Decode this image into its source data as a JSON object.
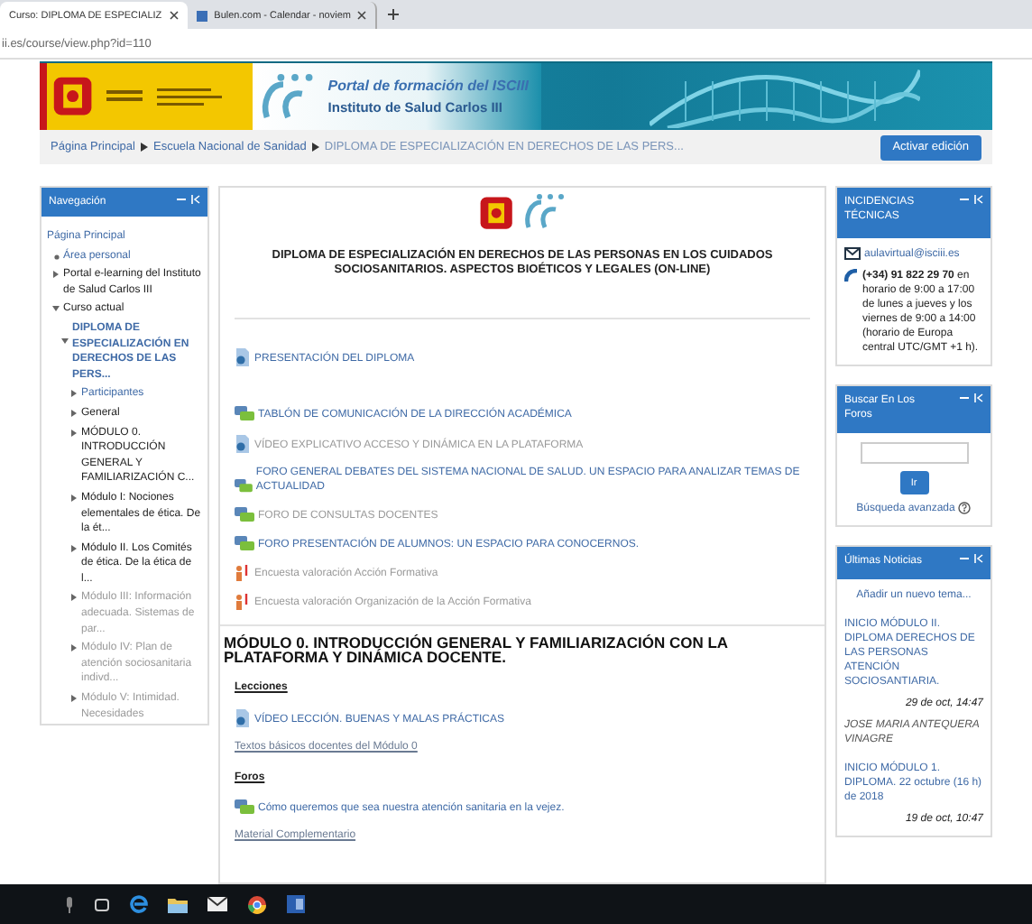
{
  "browser": {
    "tabs": [
      {
        "title": "Curso: DIPLOMA DE ESPECIALIZ",
        "selected": true
      },
      {
        "title": "Bulen.com - Calendar - noviem",
        "selected": false
      }
    ],
    "address": "ii.es/course/view.php?id=110"
  },
  "banner": {
    "title": "Portal de formación del ISCIII",
    "subtitle": "Instituto de Salud Carlos III"
  },
  "breadcrumb": [
    "Página Principal",
    "Escuela Nacional de Sanidad",
    "DIPLOMA DE ESPECIALIZACIÓN EN DERECHOS DE LAS PERS..."
  ],
  "edit_button": "Activar edición",
  "navigation": {
    "title": "Navegación",
    "items": [
      {
        "label": "Página Principal",
        "kind": "root",
        "link": true,
        "current": false,
        "dimmed": false,
        "children": [
          {
            "label": "Área personal",
            "kind": "bullet",
            "link": true,
            "current": false,
            "dimmed": false
          },
          {
            "label": "Portal e-learning del Instituto de Salud Carlos III",
            "kind": "branch",
            "link": false,
            "current": false,
            "dimmed": false,
            "expanded": false
          },
          {
            "label": "Curso actual",
            "kind": "branch",
            "link": false,
            "current": false,
            "dimmed": false,
            "expanded": true,
            "children": [
              {
                "label": "DIPLOMA DE ESPECIALIZACIÓN EN DERECHOS DE LAS PERS...",
                "kind": "branch",
                "link": true,
                "current": true,
                "dimmed": false,
                "expanded": true,
                "children": [
                  {
                    "label": "Participantes",
                    "kind": "branch",
                    "link": true,
                    "current": false,
                    "dimmed": false,
                    "expanded": false
                  },
                  {
                    "label": "General",
                    "kind": "branch",
                    "link": false,
                    "current": false,
                    "dimmed": false,
                    "expanded": false
                  },
                  {
                    "label": "MÓDULO 0. INTRODUCCIÓN GENERAL Y FAMILIARIZACIÓN C...",
                    "kind": "branch",
                    "link": false,
                    "current": false,
                    "dimmed": false,
                    "expanded": false
                  },
                  {
                    "label": "Módulo I: Nociones elementales de ética. De la ét...",
                    "kind": "branch",
                    "link": false,
                    "current": false,
                    "dimmed": false,
                    "expanded": false
                  },
                  {
                    "label": "Módulo II. Los Comités de ética. De la ética de l...",
                    "kind": "branch",
                    "link": false,
                    "current": false,
                    "dimmed": false,
                    "expanded": false
                  },
                  {
                    "label": "Módulo III: Información adecuada. Sistemas de par...",
                    "kind": "branch",
                    "link": false,
                    "current": false,
                    "dimmed": true,
                    "expanded": false
                  },
                  {
                    "label": "Módulo IV: Plan de atención sociosanitaria indivd...",
                    "kind": "branch",
                    "link": false,
                    "current": false,
                    "dimmed": true,
                    "expanded": false
                  },
                  {
                    "label": "Módulo V: Intimidad. Necesidades",
                    "kind": "branch",
                    "link": false,
                    "current": false,
                    "dimmed": true,
                    "expanded": false
                  }
                ]
              }
            ]
          }
        ]
      }
    ]
  },
  "course": {
    "title": "DIPLOMA DE ESPECIALIZACIÓN EN DERECHOS DE LAS PERSONAS EN LOS CUIDADOS SOCIOSANITARIOS. ASPECTOS BIOÉTICOS Y LEGALES (ON-LINE)",
    "groups": [
      {
        "items": [
          {
            "label": "PRESENTACIÓN DEL DIPLOMA",
            "kind": "file",
            "dimmed": false
          }
        ]
      },
      {
        "items": [
          {
            "label": "TABLÓN DE COMUNICACIÓN DE LA DIRECCIÓN ACADÉMICA",
            "kind": "forum",
            "dimmed": false
          },
          {
            "label": "VÍDEO EXPLICATIVO ACCESO Y DINÁMICA EN LA PLATAFORMA",
            "kind": "file",
            "dimmed": true
          },
          {
            "label": "FORO GENERAL DEBATES DEL SISTEMA NACIONAL DE SALUD. UN ESPACIO PARA ANALIZAR TEMAS DE ACTUALIDAD",
            "kind": "forum",
            "dimmed": false
          },
          {
            "label": "FORO DE CONSULTAS DOCENTES",
            "kind": "forum",
            "dimmed": true
          },
          {
            "label": "FORO PRESENTACIÓN DE ALUMNOS: UN ESPACIO PARA CONOCERNOS.",
            "kind": "forum",
            "dimmed": false
          },
          {
            "label": "Encuesta valoración Acción Formativa",
            "kind": "feedback",
            "dimmed": true
          },
          {
            "label": "Encuesta valoración Organización de la Acción Formativa",
            "kind": "feedback",
            "dimmed": true
          }
        ]
      }
    ],
    "sections": [
      {
        "title": "MÓDULO 0. INTRODUCCIÓN GENERAL Y FAMILIARIZACIÓN CON LA PLATAFORMA Y DINÁMICA DOCENTE.",
        "blocks": [
          {
            "heading": "Lecciones",
            "items": [
              {
                "label": "VÍDEO LECCIÓN. BUENAS Y MALAS PRÁCTICAS",
                "kind": "file",
                "dimmed": false
              },
              {
                "label": "Textos básicos docentes del Módulo 0",
                "kind": "link",
                "dimmed": false
              }
            ]
          },
          {
            "heading": "Foros",
            "items": [
              {
                "label": "Cómo queremos que sea nuestra atención sanitaria en la vejez.",
                "kind": "forum",
                "dimmed": false
              },
              {
                "label": "Material Complementario",
                "kind": "link",
                "dimmed": false
              }
            ]
          }
        ]
      }
    ]
  },
  "support": {
    "title": "INCIDENCIAS TÉCNICAS",
    "email": "aulavirtual@isciii.es",
    "hours": "**(+34) 91 822 29 70** en horario de 9:00 a 17:00 de lunes a jueves y los viernes de 9:00 a 14:00 (horario de Europa central UTC/GMT +1 h)."
  },
  "forum_search": {
    "title": "Buscar En Los Foros",
    "button": "Ir",
    "advanced": "Búsqueda avanzada"
  },
  "news": {
    "title": "Últimas Noticias",
    "add": "Añadir un nuevo tema...",
    "items": [
      {
        "title": "INICIO MÓDULO II. DIPLOMA DERECHOS DE LAS PERSONAS ATENCIÓN SOCIOSANTIARIA.",
        "date": "29 de oct, 14:47",
        "author": "JOSE MARIA ANTEQUERA VINAGRE"
      },
      {
        "title": "INICIO MÓDULO 1. DIPLOMA. 22 octubre (16 h) de 2018",
        "date": "19 de oct, 10:47"
      }
    ]
  }
}
